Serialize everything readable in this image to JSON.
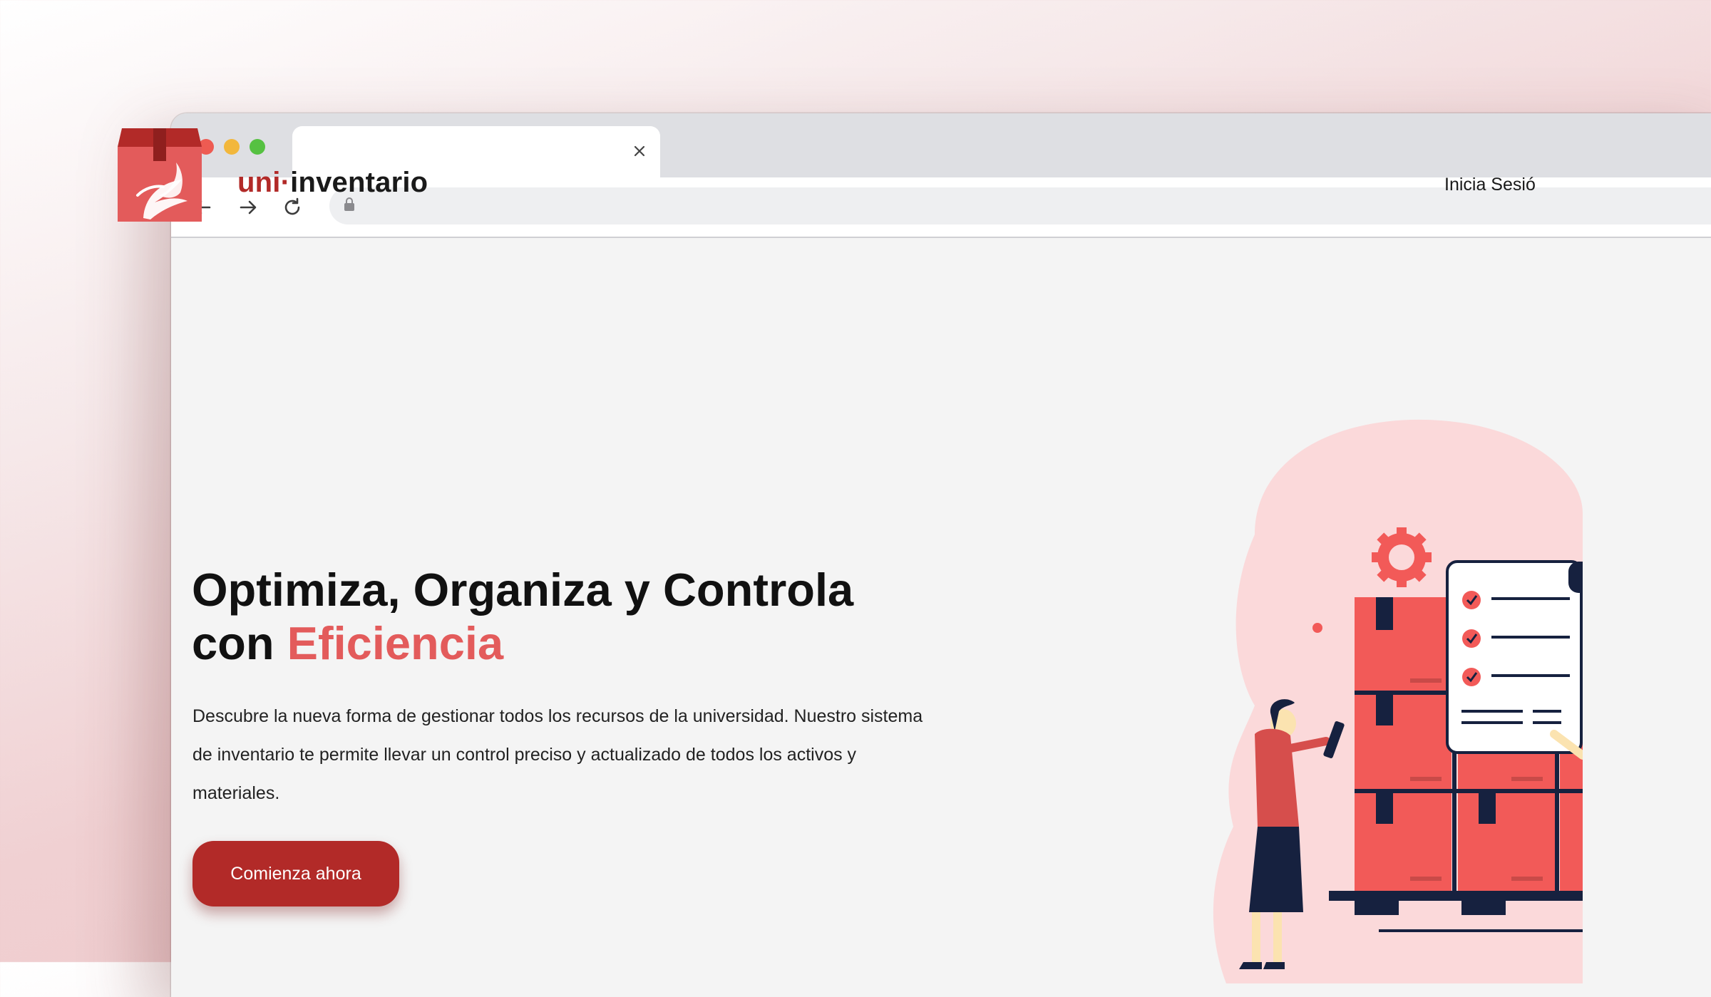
{
  "browser": {
    "tab_title": "",
    "tab_close_icon": "close-icon",
    "url": "",
    "nav_icons": [
      "back-arrow-icon",
      "forward-arrow-icon",
      "reload-icon",
      "lock-icon"
    ]
  },
  "header": {
    "brand_prefix": "uni",
    "brand_separator": "·",
    "brand_suffix": "inventario",
    "login_label": "Inicia Sesió"
  },
  "hero": {
    "title_part1": "Optimiza, Organiza y Controla",
    "title_part2": "con ",
    "title_highlight": "Eficiencia",
    "description": "Descubre la nueva forma de gestionar todos los recursos de la universidad. Nuestro sistema de inventario te permite llevar un control preciso y actualizado de todos los activos y materiales.",
    "cta_label": "Comienza ahora"
  },
  "colors": {
    "brand_red": "#b22a28",
    "accent_red": "#e35b5b",
    "box_red": "#f25a58",
    "navy": "#16213f"
  }
}
